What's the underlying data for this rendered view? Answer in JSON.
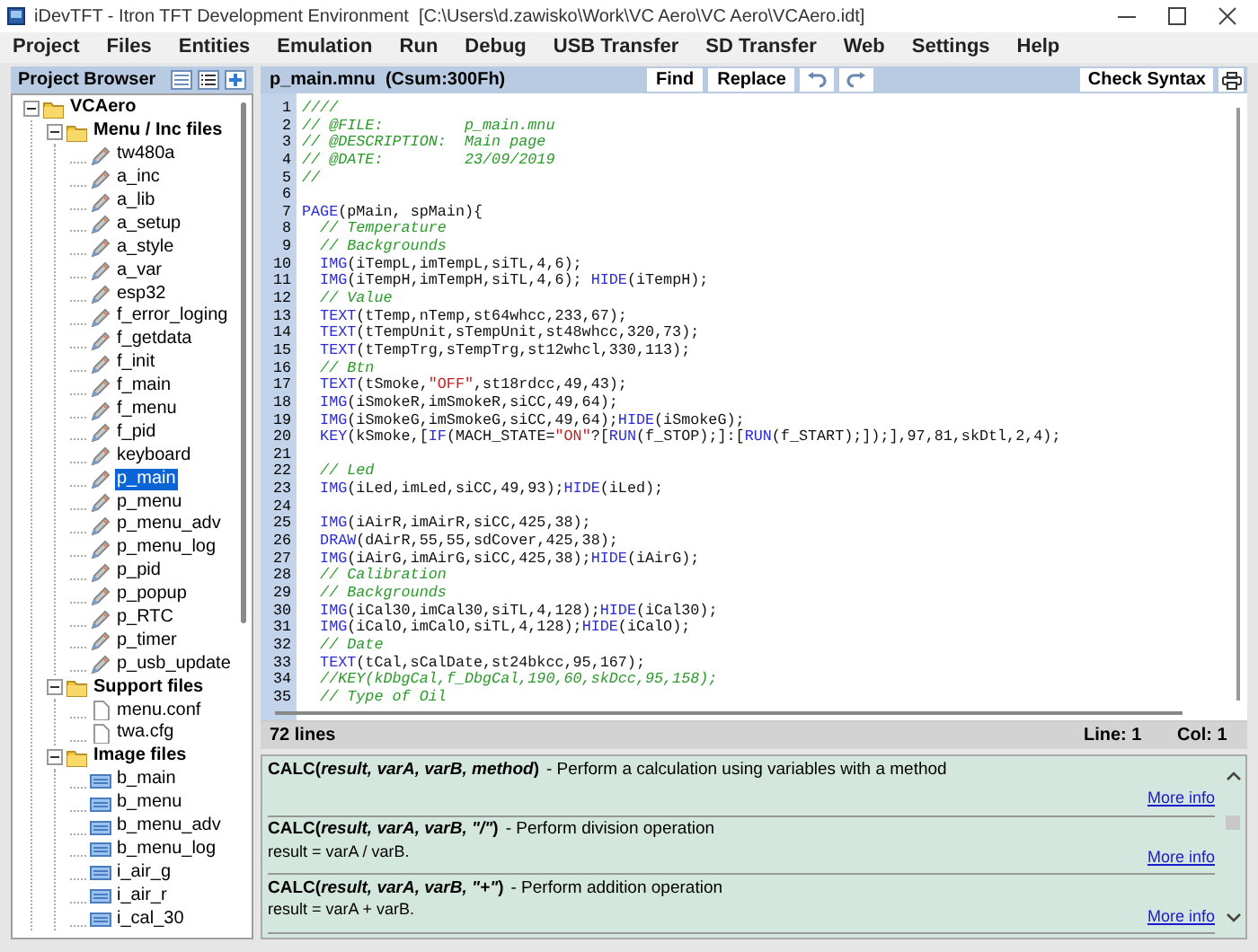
{
  "window": {
    "title": "iDevTFT - Itron TFT Development Environment  [C:\\Users\\d.zawisko\\Work\\VC Aero\\VC Aero\\VCAero.idt]"
  },
  "menu": [
    "Project",
    "Files",
    "Entities",
    "Emulation",
    "Run",
    "Debug",
    "USB Transfer",
    "SD Transfer",
    "Web",
    "Settings",
    "Help"
  ],
  "project_browser": {
    "title": "Project Browser",
    "tree": [
      {
        "label": "VCAero",
        "kind": "folder",
        "expanded": true,
        "selected": false,
        "children": [
          {
            "label": "Menu / Inc files",
            "kind": "folder",
            "expanded": true,
            "selected": false,
            "children": [
              {
                "label": "tw480a",
                "kind": "script",
                "selected": false
              },
              {
                "label": "a_inc",
                "kind": "script",
                "selected": false
              },
              {
                "label": "a_lib",
                "kind": "script",
                "selected": false
              },
              {
                "label": "a_setup",
                "kind": "script",
                "selected": false
              },
              {
                "label": "a_style",
                "kind": "script",
                "selected": false
              },
              {
                "label": "a_var",
                "kind": "script",
                "selected": false
              },
              {
                "label": "esp32",
                "kind": "script",
                "selected": false
              },
              {
                "label": "f_error_loging",
                "kind": "script",
                "selected": false
              },
              {
                "label": "f_getdata",
                "kind": "script",
                "selected": false
              },
              {
                "label": "f_init",
                "kind": "script",
                "selected": false
              },
              {
                "label": "f_main",
                "kind": "script",
                "selected": false
              },
              {
                "label": "f_menu",
                "kind": "script",
                "selected": false
              },
              {
                "label": "f_pid",
                "kind": "script",
                "selected": false
              },
              {
                "label": "keyboard",
                "kind": "script",
                "selected": false
              },
              {
                "label": "p_main",
                "kind": "script",
                "selected": true
              },
              {
                "label": "p_menu",
                "kind": "script",
                "selected": false
              },
              {
                "label": "p_menu_adv",
                "kind": "script",
                "selected": false
              },
              {
                "label": "p_menu_log",
                "kind": "script",
                "selected": false
              },
              {
                "label": "p_pid",
                "kind": "script",
                "selected": false
              },
              {
                "label": "p_popup",
                "kind": "script",
                "selected": false
              },
              {
                "label": "p_RTC",
                "kind": "script",
                "selected": false
              },
              {
                "label": "p_timer",
                "kind": "script",
                "selected": false
              },
              {
                "label": "p_usb_update",
                "kind": "script",
                "selected": false
              }
            ]
          },
          {
            "label": "Support files",
            "kind": "folder",
            "expanded": true,
            "selected": false,
            "children": [
              {
                "label": "menu.conf",
                "kind": "config",
                "selected": false
              },
              {
                "label": "twa.cfg",
                "kind": "config",
                "selected": false
              }
            ]
          },
          {
            "label": "Image files",
            "kind": "folder",
            "expanded": true,
            "selected": false,
            "children": [
              {
                "label": "b_main",
                "kind": "image",
                "selected": false
              },
              {
                "label": "b_menu",
                "kind": "image",
                "selected": false
              },
              {
                "label": "b_menu_adv",
                "kind": "image",
                "selected": false
              },
              {
                "label": "b_menu_log",
                "kind": "image",
                "selected": false
              },
              {
                "label": "i_air_g",
                "kind": "image",
                "selected": false
              },
              {
                "label": "i_air_r",
                "kind": "image",
                "selected": false
              },
              {
                "label": "i_cal_30",
                "kind": "image",
                "selected": false
              }
            ]
          }
        ]
      }
    ]
  },
  "editor": {
    "title": "p_main.mnu  (Csum:300Fh)",
    "buttons": [
      "Find",
      "Replace"
    ],
    "check_button": "Check Syntax",
    "lines": [
      {
        "number": "1",
        "segments": [
          {
            "kind": "comment",
            "text": "////"
          }
        ]
      },
      {
        "number": "2",
        "segments": [
          {
            "kind": "comment",
            "text": "// @FILE:         p_main.mnu"
          }
        ]
      },
      {
        "number": "3",
        "segments": [
          {
            "kind": "comment",
            "text": "// @DESCRIPTION:  Main page"
          }
        ]
      },
      {
        "number": "4",
        "segments": [
          {
            "kind": "comment",
            "text": "// @DATE:         23/09/2019"
          }
        ]
      },
      {
        "number": "5",
        "segments": [
          {
            "kind": "comment",
            "text": "//"
          }
        ]
      },
      {
        "number": "6"
      },
      {
        "number": "7",
        "segments": [
          {
            "kind": "keyword",
            "text": "PAGE"
          },
          {
            "kind": "plain",
            "text": "(pMain, spMain){"
          }
        ]
      },
      {
        "number": "8",
        "segments": [
          {
            "kind": "comment",
            "text": "  // Temperature"
          }
        ]
      },
      {
        "number": "9",
        "segments": [
          {
            "kind": "comment",
            "text": "  // Backgrounds"
          }
        ]
      },
      {
        "number": "10",
        "segments": [
          {
            "kind": "keyword",
            "text": "  IMG"
          },
          {
            "kind": "plain",
            "text": "(iTempL,imTempL,siTL,4,6);"
          }
        ]
      },
      {
        "number": "11",
        "segments": [
          {
            "kind": "keyword",
            "text": "  IMG"
          },
          {
            "kind": "plain",
            "text": "(iTempH,imTempH,siTL,4,6); "
          },
          {
            "kind": "keyword",
            "text": "HIDE"
          },
          {
            "kind": "plain",
            "text": "(iTempH);"
          }
        ]
      },
      {
        "number": "12",
        "segments": [
          {
            "kind": "comment",
            "text": "  // Value"
          }
        ]
      },
      {
        "number": "13",
        "segments": [
          {
            "kind": "keyword",
            "text": "  TEXT"
          },
          {
            "kind": "plain",
            "text": "(tTemp,nTemp,st64whcc,233,67);"
          }
        ]
      },
      {
        "number": "14",
        "segments": [
          {
            "kind": "keyword",
            "text": "  TEXT"
          },
          {
            "kind": "plain",
            "text": "(tTempUnit,sTempUnit,st48whcc,320,73);"
          }
        ]
      },
      {
        "number": "15",
        "segments": [
          {
            "kind": "keyword",
            "text": "  TEXT"
          },
          {
            "kind": "plain",
            "text": "(tTempTrg,sTempTrg,st12whcl,330,113);"
          }
        ]
      },
      {
        "number": "16",
        "segments": [
          {
            "kind": "comment",
            "text": "  // Btn"
          }
        ]
      },
      {
        "number": "17",
        "segments": [
          {
            "kind": "keyword",
            "text": "  TEXT"
          },
          {
            "kind": "plain",
            "text": "(tSmoke,"
          },
          {
            "kind": "string",
            "text": "\"OFF\""
          },
          {
            "kind": "plain",
            "text": ",st18rdcc,49,43);"
          }
        ]
      },
      {
        "number": "18",
        "segments": [
          {
            "kind": "keyword",
            "text": "  IMG"
          },
          {
            "kind": "plain",
            "text": "(iSmokeR,imSmokeR,siCC,49,64);"
          }
        ]
      },
      {
        "number": "19",
        "segments": [
          {
            "kind": "keyword",
            "text": "  IMG"
          },
          {
            "kind": "plain",
            "text": "(iSmokeG,imSmokeG,siCC,49,64);"
          },
          {
            "kind": "keyword",
            "text": "HIDE"
          },
          {
            "kind": "plain",
            "text": "(iSmokeG);"
          }
        ]
      },
      {
        "number": "20",
        "segments": [
          {
            "kind": "keyword",
            "text": "  KEY"
          },
          {
            "kind": "plain",
            "text": "(kSmoke,["
          },
          {
            "kind": "keyword",
            "text": "IF"
          },
          {
            "kind": "plain",
            "text": "(MACH_STATE="
          },
          {
            "kind": "string",
            "text": "\"ON\""
          },
          {
            "kind": "plain",
            "text": "?["
          },
          {
            "kind": "keyword",
            "text": "RUN"
          },
          {
            "kind": "plain",
            "text": "(f_STOP);]:["
          },
          {
            "kind": "keyword",
            "text": "RUN"
          },
          {
            "kind": "plain",
            "text": "(f_START);]);],97,81,skDtl,2,4);"
          }
        ]
      },
      {
        "number": "21"
      },
      {
        "number": "22",
        "segments": [
          {
            "kind": "comment",
            "text": "  // Led"
          }
        ]
      },
      {
        "number": "23",
        "segments": [
          {
            "kind": "keyword",
            "text": "  IMG"
          },
          {
            "kind": "plain",
            "text": "(iLed,imLed,siCC,49,93);"
          },
          {
            "kind": "keyword",
            "text": "HIDE"
          },
          {
            "kind": "plain",
            "text": "(iLed);"
          }
        ]
      },
      {
        "number": "24"
      },
      {
        "number": "25",
        "segments": [
          {
            "kind": "keyword",
            "text": "  IMG"
          },
          {
            "kind": "plain",
            "text": "(iAirR,imAirR,siCC,425,38);"
          }
        ]
      },
      {
        "number": "26",
        "segments": [
          {
            "kind": "keyword",
            "text": "  DRAW"
          },
          {
            "kind": "plain",
            "text": "(dAirR,55,55,sdCover,425,38);"
          }
        ]
      },
      {
        "number": "27",
        "segments": [
          {
            "kind": "keyword",
            "text": "  IMG"
          },
          {
            "kind": "plain",
            "text": "(iAirG,imAirG,siCC,425,38);"
          },
          {
            "kind": "keyword",
            "text": "HIDE"
          },
          {
            "kind": "plain",
            "text": "(iAirG);"
          }
        ]
      },
      {
        "number": "28",
        "segments": [
          {
            "kind": "comment",
            "text": "  // Calibration"
          }
        ]
      },
      {
        "number": "29",
        "segments": [
          {
            "kind": "comment",
            "text": "  // Backgrounds"
          }
        ]
      },
      {
        "number": "30",
        "segments": [
          {
            "kind": "keyword",
            "text": "  IMG"
          },
          {
            "kind": "plain",
            "text": "(iCal30,imCal30,siTL,4,128);"
          },
          {
            "kind": "keyword",
            "text": "HIDE"
          },
          {
            "kind": "plain",
            "text": "(iCal30);"
          }
        ]
      },
      {
        "number": "31",
        "segments": [
          {
            "kind": "keyword",
            "text": "  IMG"
          },
          {
            "kind": "plain",
            "text": "(iCalO,imCalO,siTL,4,128);"
          },
          {
            "kind": "keyword",
            "text": "HIDE"
          },
          {
            "kind": "plain",
            "text": "(iCalO);"
          }
        ]
      },
      {
        "number": "32",
        "segments": [
          {
            "kind": "comment",
            "text": "  // Date"
          }
        ]
      },
      {
        "number": "33",
        "segments": [
          {
            "kind": "keyword",
            "text": "  TEXT"
          },
          {
            "kind": "plain",
            "text": "(tCal,sCalDate,st24bkcc,95,167);"
          }
        ]
      },
      {
        "number": "34",
        "segments": [
          {
            "kind": "comment",
            "text": "  //KEY(kDbgCal,f_DbgCal,190,60,skDcc,95,158);"
          }
        ]
      },
      {
        "number": "35",
        "segments": [
          {
            "kind": "comment",
            "text": "  // Type of Oil"
          }
        ]
      }
    ]
  },
  "status_bar": {
    "lines": "72 lines",
    "line": "Line: 1",
    "col": "Col: 1"
  },
  "help": [
    {
      "signature": "CALC(*result, varA, varB, method*)",
      "description": "- Perform a calculation using variables with a method",
      "link": "More info"
    },
    {
      "signature": "CALC(*result, varA, varB, \"/\"*)",
      "description": "- Perform division operation",
      "detail": "result = varA / varB.",
      "link": "More info"
    },
    {
      "signature": "CALC(*result, varA, varB, \"+\"*)",
      "description": "- Perform addition operation",
      "detail": "result = varA + varB.",
      "link": "More info"
    }
  ]
}
